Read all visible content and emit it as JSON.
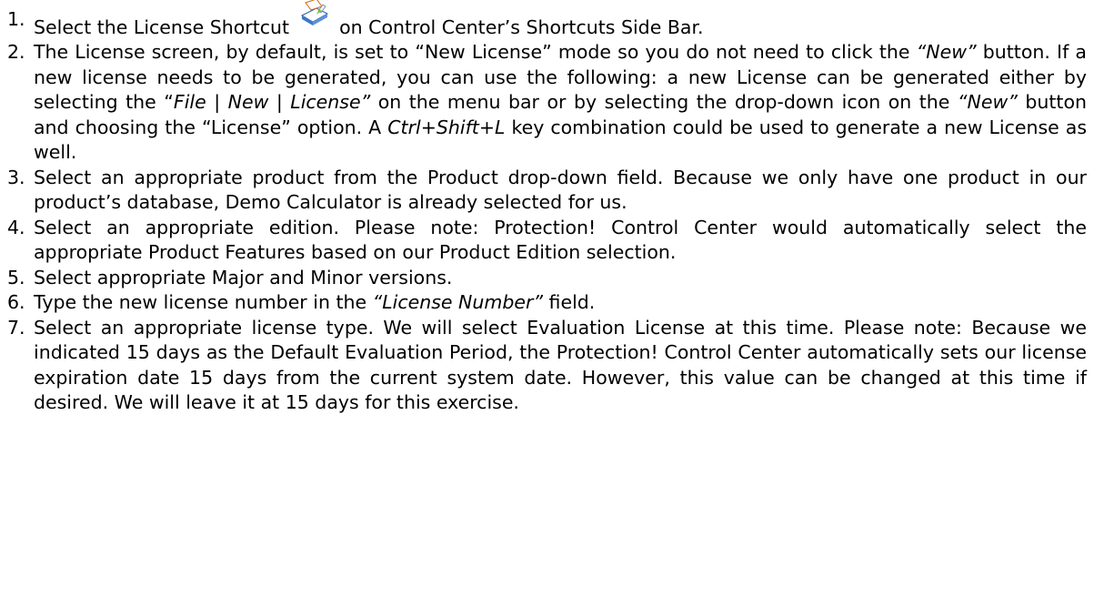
{
  "steps": [
    {
      "num": "1.",
      "parts": [
        {
          "t": "Select the License Shortcut "
        },
        {
          "icon": "license-shortcut-icon"
        },
        {
          "t": " on Control Center’s Shortcuts Side Bar."
        }
      ]
    },
    {
      "num": "2.",
      "parts": [
        {
          "t": "The License screen, by default, is set to “New License” mode so you do not need to click the "
        },
        {
          "t": "“New”",
          "i": true
        },
        {
          "t": " button.  If a new license needs to be generated, you can use the following: a new License can be generated either by selecting the “"
        },
        {
          "t": "File | New | License”",
          "i": true
        },
        {
          "t": " on the menu bar or by selecting the drop-down icon on the "
        },
        {
          "t": "“New”",
          "i": true
        },
        {
          "t": " button and choosing the “License” option. A "
        },
        {
          "t": "Ctrl+Shift+L",
          "i": true
        },
        {
          "t": " key combination could be used to generate a new License as well."
        }
      ]
    },
    {
      "num": "3.",
      "parts": [
        {
          "t": "Select an appropriate product from the Product drop-down field. Because we only have one product in our product’s database, Demo Calculator is already selected for us."
        }
      ]
    },
    {
      "num": "4.",
      "parts": [
        {
          "t": "Select an appropriate edition. Please note: Protection! Control Center would automatically select the appropriate Product Features based on our Product Edition selection."
        }
      ]
    },
    {
      "num": "5.",
      "parts": [
        {
          "t": "Select appropriate Major and Minor versions."
        }
      ]
    },
    {
      "num": "6.",
      "parts": [
        {
          "t": "Type the new license number in the "
        },
        {
          "t": "“License Number”",
          "i": true
        },
        {
          "t": " field."
        }
      ]
    },
    {
      "num": "7.",
      "parts": [
        {
          "t": "Select an appropriate license type. We will select Evaluation License at this time. Please note: Because we indicated 15 days as the Default Evaluation Period, the Protection! Control Center automatically sets our license expiration date 15 days from the current system date. However, this value can be changed at this time if desired. We will leave it at 15 days for this exercise."
        }
      ]
    }
  ]
}
